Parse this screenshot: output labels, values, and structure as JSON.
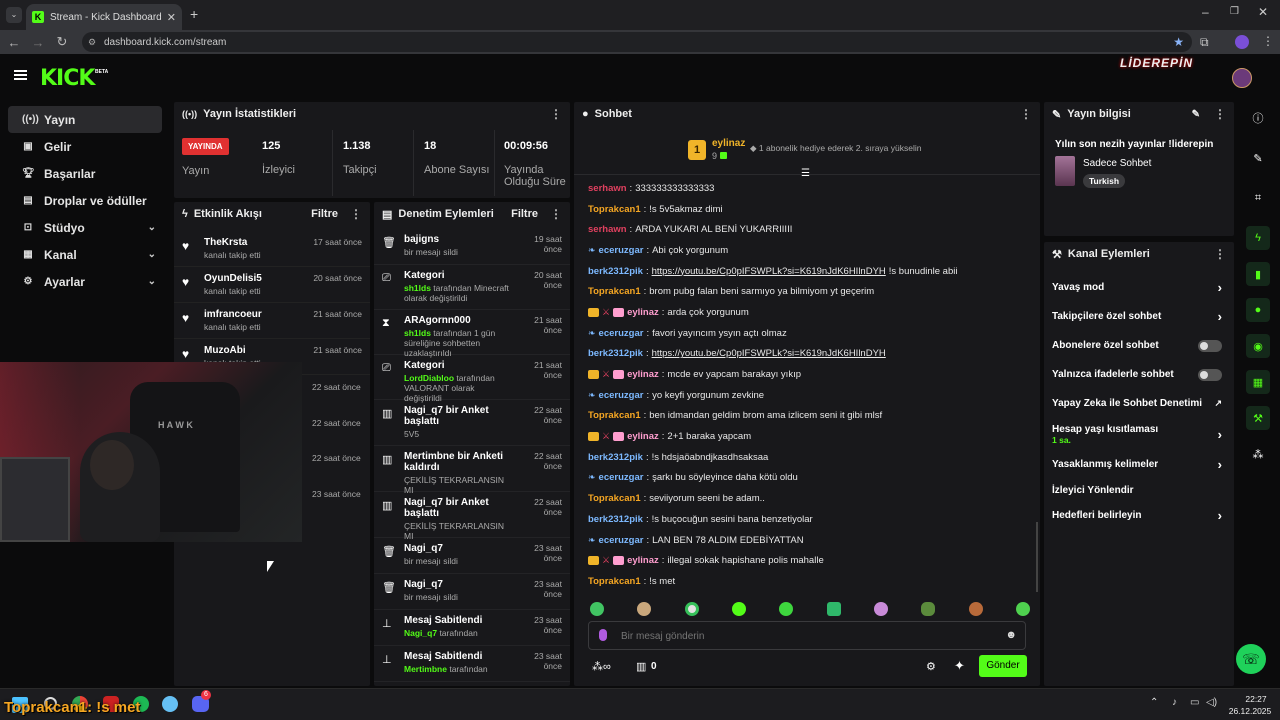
{
  "browser": {
    "tab_title": "Stream - Kick Dashboard",
    "url": "dashboard.kick.com/stream"
  },
  "header": {
    "logo": "KICK",
    "beta": "BETA",
    "brand_right": "LİDEREPİN"
  },
  "sidebar": {
    "items": [
      {
        "label": "Yayın",
        "icon": "broadcast-icon"
      },
      {
        "label": "Gelir",
        "icon": "money-icon"
      },
      {
        "label": "Başarılar",
        "icon": "trophy-icon"
      },
      {
        "label": "Droplar ve ödüller",
        "icon": "gift-icon"
      },
      {
        "label": "Stüdyo",
        "icon": "studio-icon"
      },
      {
        "label": "Kanal",
        "icon": "channel-icon"
      },
      {
        "label": "Ayarlar",
        "icon": "gear-icon"
      }
    ]
  },
  "stats": {
    "title": "Yayın İstatistikleri",
    "live": "YAYINDA",
    "live_label": "Yayın",
    "viewers": "125",
    "viewers_label": "İzleyici",
    "followers": "1.138",
    "followers_label": "Takipçi",
    "subs": "18",
    "subs_label": "Abone Sayısı",
    "uptime": "00:09:56",
    "uptime_label": "Yayında Olduğu Süre"
  },
  "events": {
    "title": "Etkinlik Akışı",
    "filter": "Filtre",
    "items": [
      {
        "name": "TheKrsta",
        "sub": "kanalı takip etti",
        "time": "17 saat önce"
      },
      {
        "name": "OyunDelisi5",
        "sub": "kanalı takip etti",
        "time": "20 saat önce"
      },
      {
        "name": "imfrancoeur",
        "sub": "kanalı takip etti",
        "time": "21 saat önce"
      },
      {
        "name": "MuzoAbi",
        "sub": "kanalı takip etti",
        "time": "21 saat önce"
      }
    ],
    "extra_times": [
      "22 saat önce",
      "22 saat önce",
      "22 saat önce",
      "23 saat önce"
    ]
  },
  "mod": {
    "title": "Denetim Eylemleri",
    "filter": "Filtre",
    "items": [
      {
        "name": "bajigns",
        "pre": "",
        "hl": "",
        "post": "bir mesajı sildi",
        "time": "19 saat önce",
        "icon": "trash-icon"
      },
      {
        "name": "Kategori",
        "pre": "",
        "hl": "sh1lds",
        "post": " tarafından Minecraft olarak değiştirildi",
        "time": "20 saat önce",
        "icon": "category-icon"
      },
      {
        "name": "ARAgornn000",
        "pre": "",
        "hl": "sh1lds",
        "post": " tarafından 1 gün süreliğine sohbetten uzaklaştırıldı",
        "time": "21 saat önce",
        "icon": "hourglass-icon"
      },
      {
        "name": "Kategori",
        "pre": "",
        "hl": "LordDiabloo",
        "post": " tarafından VALORANT olarak değiştirildi",
        "time": "21 saat önce",
        "icon": "category-icon"
      },
      {
        "name": "Nagi_q7 bir Anket başlattı",
        "pre": "",
        "hl": "",
        "post": "5V5",
        "time": "22 saat önce",
        "icon": "poll-icon"
      },
      {
        "name": "Mertimbne bir Anketi kaldırdı",
        "pre": "",
        "hl": "",
        "post": "ÇEKİLİŞ TEKRARLANSIN MI",
        "time": "22 saat önce",
        "icon": "poll-icon"
      },
      {
        "name": "Nagi_q7 bir Anket başlattı",
        "pre": "",
        "hl": "",
        "post": "ÇEKİLİŞ TEKRARLANSIN MI",
        "time": "22 saat önce",
        "icon": "poll-icon"
      },
      {
        "name": "Nagi_q7",
        "pre": "",
        "hl": "",
        "post": "bir mesajı sildi",
        "time": "23 saat önce",
        "icon": "trash-icon"
      },
      {
        "name": "Nagi_q7",
        "pre": "",
        "hl": "",
        "post": "bir mesajı sildi",
        "time": "23 saat önce",
        "icon": "trash-icon"
      },
      {
        "name": "Mesaj Sabitlendi",
        "pre": "",
        "hl": "Nagi_q7",
        "post": " tarafından",
        "time": "23 saat önce",
        "icon": "pin-icon"
      },
      {
        "name": "Mesaj Sabitlendi",
        "pre": "",
        "hl": "Mertimbne",
        "post": " tarafından",
        "time": "23 saat önce",
        "icon": "pin-icon"
      }
    ]
  },
  "chat": {
    "title": "Sohbet",
    "top_user": "eylinaz",
    "top_count": "9",
    "top_rank": "1",
    "promo": "1 abonelik hediye ederek 2. sıraya yükselin",
    "messages": [
      {
        "user": "serhawn",
        "color": "#e0405f",
        "text": "333333333333333",
        "link": "",
        "after": "",
        "badges": ""
      },
      {
        "user": "Toprakcan1",
        "color": "#f5a623",
        "text": "!s 5v5akmaz dimi",
        "link": "",
        "after": "",
        "badges": ""
      },
      {
        "user": "serhawn",
        "color": "#e0405f",
        "text": "ARDA YUKARI AL BENİ YUKARRIIIII",
        "link": "",
        "after": "",
        "badges": ""
      },
      {
        "user": "eceruzgar",
        "color": "#7db9ff",
        "text": "Abi çok yorgunum",
        "link": "",
        "after": "",
        "badges": "v"
      },
      {
        "user": "berk2312pik",
        "color": "#7db9ff",
        "text": "",
        "link": "https://youtu.be/Cp0pIFSWPLk?si=K619nJdK6HIlnDYH",
        "after": " !s bunudinle abii",
        "badges": ""
      },
      {
        "user": "Toprakcan1",
        "color": "#f5a623",
        "text": "brom pubg falan beni sarmıyo ya bilmiyom yt geçerim",
        "link": "",
        "after": "",
        "badges": ""
      },
      {
        "user": "eylinaz",
        "color": "#ff9ecf",
        "text": "arda çok yorgunum",
        "link": "",
        "after": "",
        "badges": "csg"
      },
      {
        "user": "eceruzgar",
        "color": "#7db9ff",
        "text": "favori yayıncım ysyın açtı olmaz",
        "link": "",
        "after": "",
        "badges": "v"
      },
      {
        "user": "berk2312pik",
        "color": "#7db9ff",
        "text": "",
        "link": "https://youtu.be/Cp0pIFSWPLk?si=K619nJdK6HIlnDYH",
        "after": "",
        "badges": ""
      },
      {
        "user": "eylinaz",
        "color": "#ff9ecf",
        "text": "mcde ev yapcam barakayı yıkıp",
        "link": "",
        "after": "",
        "badges": "csg"
      },
      {
        "user": "eceruzgar",
        "color": "#7db9ff",
        "text": "yo keyfi yorgunum zevkine",
        "link": "",
        "after": "",
        "badges": "v"
      },
      {
        "user": "Toprakcan1",
        "color": "#f5a623",
        "text": "ben idmandan geldim brom ama izlicem seni it gibi mlsf",
        "link": "",
        "after": "",
        "badges": ""
      },
      {
        "user": "eylinaz",
        "color": "#ff9ecf",
        "text": "2+1 baraka yapcam",
        "link": "",
        "after": "",
        "badges": "csg"
      },
      {
        "user": "berk2312pik",
        "color": "#7db9ff",
        "text": "!s hdsjaöabndjkasdhsaksaa",
        "link": "",
        "after": "",
        "badges": ""
      },
      {
        "user": "eceruzgar",
        "color": "#7db9ff",
        "text": "şarkı bu söyleyince daha kötü oldu",
        "link": "",
        "after": "",
        "badges": "v"
      },
      {
        "user": "Toprakcan1",
        "color": "#f5a623",
        "text": "seviiyorum seeni be adam..",
        "link": "",
        "after": "",
        "badges": ""
      },
      {
        "user": "berk2312pik",
        "color": "#7db9ff",
        "text": "!s buçocuğun sesini bana benzetiyolar",
        "link": "",
        "after": "",
        "badges": ""
      },
      {
        "user": "eceruzgar",
        "color": "#7db9ff",
        "text": "LAN BEN 78 ALDIM EDEBİYATTAN",
        "link": "",
        "after": "",
        "badges": "v"
      },
      {
        "user": "eylinaz",
        "color": "#ff9ecf",
        "text": "illegal sokak hapishane polis mahalle",
        "link": "",
        "after": "",
        "badges": "csg"
      },
      {
        "user": "Toprakcan1",
        "color": "#f5a623",
        "text": "!s met",
        "link": "",
        "after": "",
        "badges": ""
      }
    ],
    "input_placeholder": "Bir mesaj gönderin",
    "points": "0",
    "send": "Gönder"
  },
  "info": {
    "title": "Yayın bilgisi",
    "stream_title": "Yılın son nezih yayınlar !liderepin",
    "category": "Sadece Sohbet",
    "tag": "Turkish"
  },
  "channel_actions": {
    "title": "Kanal Eylemleri",
    "items": [
      {
        "label": "Yavaş mod",
        "kind": "chev",
        "sub": ""
      },
      {
        "label": "Takipçilere özel sohbet",
        "kind": "chev",
        "sub": ""
      },
      {
        "label": "Abonelere özel sohbet",
        "kind": "toggle",
        "sub": ""
      },
      {
        "label": "Yalnızca ifadelerle sohbet",
        "kind": "toggle",
        "sub": ""
      },
      {
        "label": "Yapay Zeka ile Sohbet Denetimi",
        "kind": "ext",
        "sub": ""
      },
      {
        "label": "Hesap yaşı kısıtlaması",
        "kind": "chev",
        "sub": "1 sa."
      },
      {
        "label": "Yasaklanmış kelimeler",
        "kind": "chev",
        "sub": ""
      },
      {
        "label": "İzleyici Yönlendir",
        "kind": "none",
        "sub": ""
      },
      {
        "label": "Hedefleri belirleyin",
        "kind": "chev",
        "sub": ""
      }
    ]
  },
  "overlay_caption": "Toprakcan1: !s met",
  "taskbar": {
    "time": "22:27",
    "date": "26.12.2025",
    "discord_badge": "6"
  }
}
